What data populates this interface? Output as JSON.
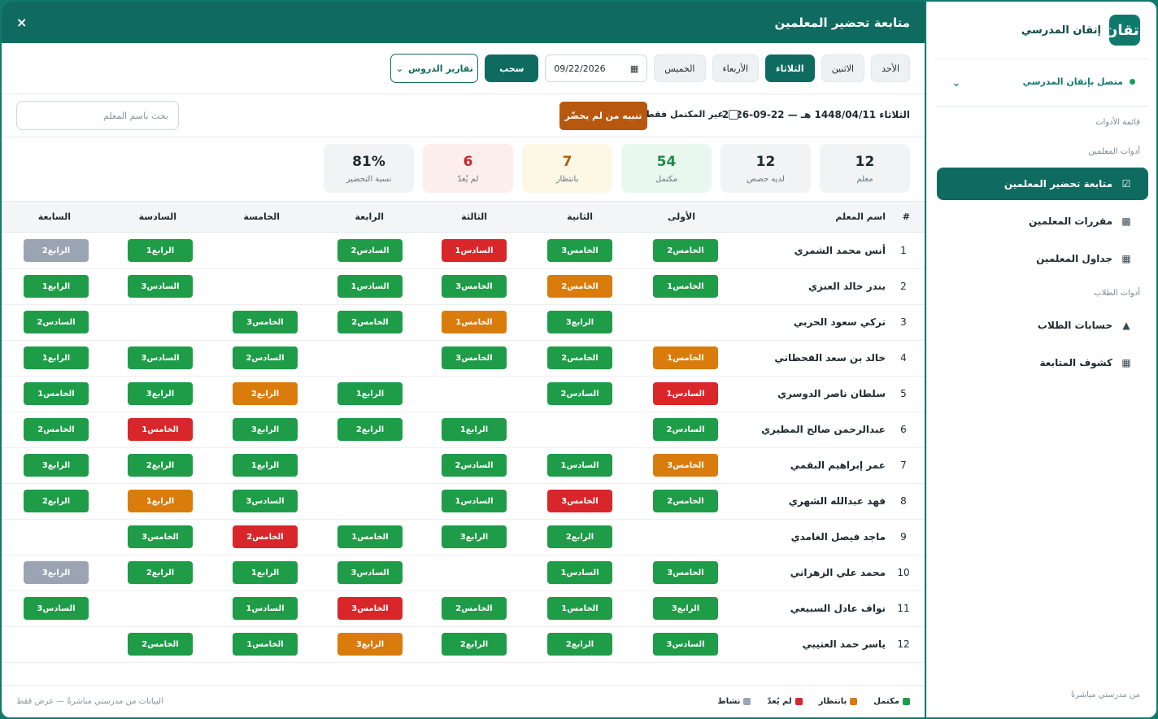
{
  "sidebar": {
    "logo_text": "إتقان",
    "brand": "إتقان المدرسي",
    "connection": "متصل بإتقان المدرسي",
    "sections": [
      "قائمة الأدوات",
      "أدوات المعلمين",
      "أدوات الطلاب"
    ],
    "teacher_items": [
      {
        "label": "متابعة تحضير المعلمين",
        "icon": "clipboard-check-icon",
        "active": true
      },
      {
        "label": "مقررات المعلمين",
        "icon": "book-icon",
        "active": false
      },
      {
        "label": "جداول المعلمين",
        "icon": "calendar-icon",
        "active": false
      }
    ],
    "student_items": [
      {
        "label": "حسابات الطلاب",
        "icon": "graduation-cap-icon"
      },
      {
        "label": "كشوف المتابعة",
        "icon": "table-icon"
      }
    ],
    "footer": "من مدرستي مباشرةً"
  },
  "header": {
    "title": "متابعة تحضير المعلمين",
    "close": "×"
  },
  "toolbar": {
    "days": [
      {
        "label": "الأحد",
        "active": false
      },
      {
        "label": "الاثنين",
        "active": false
      },
      {
        "label": "الثلاثاء",
        "active": true
      },
      {
        "label": "الأربعاء",
        "active": false
      },
      {
        "label": "الخميس",
        "active": false
      }
    ],
    "date_value": "09/22/2026",
    "pull_label": "سحب",
    "report_label": "تقارير الدروس"
  },
  "info": {
    "date_text": "الثلاثاء 1448/04/11 هـ — 22-09-2026",
    "checkbox_label": "غير المكتمل فقط",
    "alert_label": "تنبيه من لم يحضّر",
    "search_placeholder": "بحث باسم المعلم"
  },
  "stats": [
    {
      "value": "12",
      "label": "معلم",
      "bg": "#f1f3f5",
      "color": "#1f2a2e"
    },
    {
      "value": "12",
      "label": "لديه حصص",
      "bg": "#f1f3f5",
      "color": "#1f2a2e"
    },
    {
      "value": "54",
      "label": "مكتمل",
      "bg": "#e9f8ef",
      "color": "#1e8a48"
    },
    {
      "value": "7",
      "label": "بانتظار",
      "bg": "#fdf8e6",
      "color": "#b8580e"
    },
    {
      "value": "6",
      "label": "لم يُعدّ",
      "bg": "#fdeeee",
      "color": "#c62828"
    },
    {
      "value": "81%",
      "label": "نسبة التحضير",
      "bg": "#f1f3f5",
      "color": "#1f2a2e"
    }
  ],
  "table": {
    "headers": [
      "#",
      "اسم المعلم",
      "الأولى",
      "الثانية",
      "الثالثة",
      "الرابعة",
      "الخامسة",
      "السادسة",
      "السابعة"
    ],
    "rows": [
      {
        "num": "1",
        "name": "أنس محمد الشمري",
        "cells": [
          {
            "t": "الخامس2",
            "c": "g"
          },
          {
            "t": "الخامس3",
            "c": "g"
          },
          {
            "t": "السادس1",
            "c": "r"
          },
          {
            "t": "السادس2",
            "c": "g"
          },
          null,
          {
            "t": "الرابع1",
            "c": "g"
          },
          {
            "t": "الرابع2",
            "c": "s"
          }
        ]
      },
      {
        "num": "2",
        "name": "بندر خالد العنزي",
        "cells": [
          {
            "t": "الخامس1",
            "c": "g"
          },
          {
            "t": "الخامس2",
            "c": "o"
          },
          {
            "t": "الخامس3",
            "c": "g"
          },
          {
            "t": "السادس1",
            "c": "g"
          },
          null,
          {
            "t": "السادس3",
            "c": "g"
          },
          {
            "t": "الرابع1",
            "c": "g"
          }
        ]
      },
      {
        "num": "3",
        "name": "تركي سعود الحربي",
        "cells": [
          null,
          {
            "t": "الرابع3",
            "c": "g"
          },
          {
            "t": "الخامس1",
            "c": "o"
          },
          {
            "t": "الخامس2",
            "c": "g"
          },
          {
            "t": "الخامس3",
            "c": "g"
          },
          null,
          {
            "t": "السادس2",
            "c": "g"
          }
        ]
      },
      {
        "num": "4",
        "name": "خالد بن سعد القحطاني",
        "cells": [
          {
            "t": "الخامس1",
            "c": "o"
          },
          {
            "t": "الخامس2",
            "c": "g"
          },
          {
            "t": "الخامس3",
            "c": "g"
          },
          null,
          {
            "t": "السادس2",
            "c": "g"
          },
          {
            "t": "السادس3",
            "c": "g"
          },
          {
            "t": "الرابع1",
            "c": "g"
          }
        ]
      },
      {
        "num": "5",
        "name": "سلطان ناصر الدوسري",
        "cells": [
          {
            "t": "السادس1",
            "c": "r"
          },
          {
            "t": "السادس2",
            "c": "g"
          },
          null,
          {
            "t": "الرابع1",
            "c": "g"
          },
          {
            "t": "الرابع2",
            "c": "o"
          },
          {
            "t": "الرابع3",
            "c": "g"
          },
          {
            "t": "الخامس1",
            "c": "g"
          }
        ]
      },
      {
        "num": "6",
        "name": "عبدالرحمن صالح المطيري",
        "cells": [
          {
            "t": "السادس2",
            "c": "g"
          },
          null,
          {
            "t": "الرابع1",
            "c": "g"
          },
          {
            "t": "الرابع2",
            "c": "g"
          },
          {
            "t": "الرابع3",
            "c": "g"
          },
          {
            "t": "الخامس1",
            "c": "r"
          },
          {
            "t": "الخامس2",
            "c": "g"
          }
        ]
      },
      {
        "num": "7",
        "name": "عمر إبراهيم البقمي",
        "cells": [
          {
            "t": "الخامس3",
            "c": "o"
          },
          {
            "t": "السادس1",
            "c": "g"
          },
          {
            "t": "السادس2",
            "c": "g"
          },
          null,
          {
            "t": "الرابع1",
            "c": "g"
          },
          {
            "t": "الرابع2",
            "c": "g"
          },
          {
            "t": "الرابع3",
            "c": "g"
          }
        ]
      },
      {
        "num": "8",
        "name": "فهد عبدالله الشهري",
        "cells": [
          {
            "t": "الخامس2",
            "c": "g"
          },
          {
            "t": "الخامس3",
            "c": "r"
          },
          {
            "t": "السادس1",
            "c": "g"
          },
          null,
          {
            "t": "السادس3",
            "c": "g"
          },
          {
            "t": "الرابع1",
            "c": "o"
          },
          {
            "t": "الرابع2",
            "c": "g"
          }
        ]
      },
      {
        "num": "9",
        "name": "ماجد فيصل الغامدي",
        "cells": [
          null,
          {
            "t": "الرابع2",
            "c": "g"
          },
          {
            "t": "الرابع3",
            "c": "g"
          },
          {
            "t": "الخامس1",
            "c": "g"
          },
          {
            "t": "الخامس2",
            "c": "r"
          },
          {
            "t": "الخامس3",
            "c": "g"
          },
          null
        ]
      },
      {
        "num": "10",
        "name": "محمد علي الزهراني",
        "cells": [
          {
            "t": "الخامس3",
            "c": "g"
          },
          {
            "t": "السادس1",
            "c": "g"
          },
          null,
          {
            "t": "السادس3",
            "c": "g"
          },
          {
            "t": "الرابع1",
            "c": "g"
          },
          {
            "t": "الرابع2",
            "c": "g"
          },
          {
            "t": "الرابع3",
            "c": "s"
          }
        ]
      },
      {
        "num": "11",
        "name": "نواف عادل السبيعي",
        "cells": [
          {
            "t": "الرابع3",
            "c": "g"
          },
          {
            "t": "الخامس1",
            "c": "g"
          },
          {
            "t": "الخامس2",
            "c": "g"
          },
          {
            "t": "الخامس3",
            "c": "r"
          },
          {
            "t": "السادس1",
            "c": "g"
          },
          null,
          {
            "t": "السادس3",
            "c": "g"
          }
        ]
      },
      {
        "num": "12",
        "name": "ياسر حمد العتيبي",
        "cells": [
          {
            "t": "السادس3",
            "c": "g"
          },
          {
            "t": "الرابع2",
            "c": "g"
          },
          {
            "t": "الرابع2",
            "c": "g"
          },
          {
            "t": "الرابع3",
            "c": "o"
          },
          {
            "t": "الخامس1",
            "c": "g"
          },
          {
            "t": "الخامس2",
            "c": "g"
          },
          null
        ]
      }
    ]
  },
  "footer": {
    "legend": [
      {
        "label": "مكتمل",
        "color": "#1e9c48"
      },
      {
        "label": "بانتظار",
        "color": "#d97c0c"
      },
      {
        "label": "لم يُعدّ",
        "color": "#d8262a"
      },
      {
        "label": "نشاط",
        "color": "#9aa4b2"
      }
    ],
    "note": "البيانات من مدرستي مباشرةً — عرض فقط"
  }
}
